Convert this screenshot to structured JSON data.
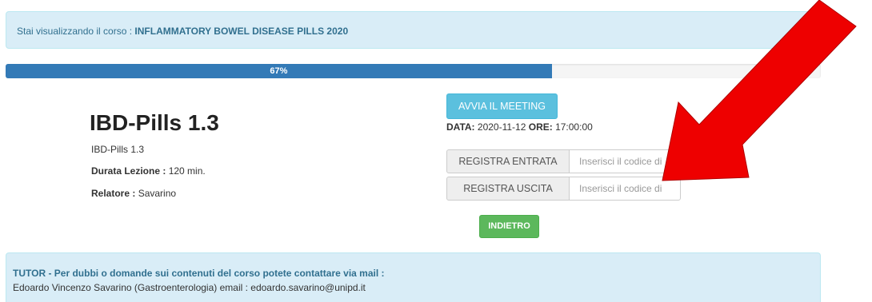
{
  "banner": {
    "prefix": "Stai visualizzando il corso : ",
    "course_name": "INFLAMMATORY BOWEL DISEASE PILLS 2020"
  },
  "progress": {
    "label": "67%",
    "value_percent": 67
  },
  "lesson": {
    "title": "IBD-Pills 1.3",
    "subtitle": "IBD-Pills 1.3",
    "duration_label": "Durata Lezione :",
    "duration_value": "120 min.",
    "speaker_label": "Relatore :",
    "speaker_value": "Savarino"
  },
  "meeting": {
    "button_label": "AVVIA IL MEETING",
    "date_label": "DATA:",
    "date_value": "2020-11-12",
    "time_label": "ORE:",
    "time_value": "17:00:00"
  },
  "attendance": {
    "entry_button": "REGISTRA ENTRATA",
    "entry_placeholder": "Inserisci il codice di",
    "exit_button": "REGISTRA USCITA",
    "exit_placeholder": "Inserisci il codice di"
  },
  "back_button": "INDIETRO",
  "tutor": {
    "title": "TUTOR - Per dubbi o domande sui contenuti del corso potete contattare via mail :",
    "contact": "Edoardo Vincenzo Savarino (Gastroenterologia) email : edoardo.savarino@unipd.it"
  },
  "annotation": {
    "arrow_color": "#ee0000",
    "icon": "red-arrow-annotation-icon"
  }
}
